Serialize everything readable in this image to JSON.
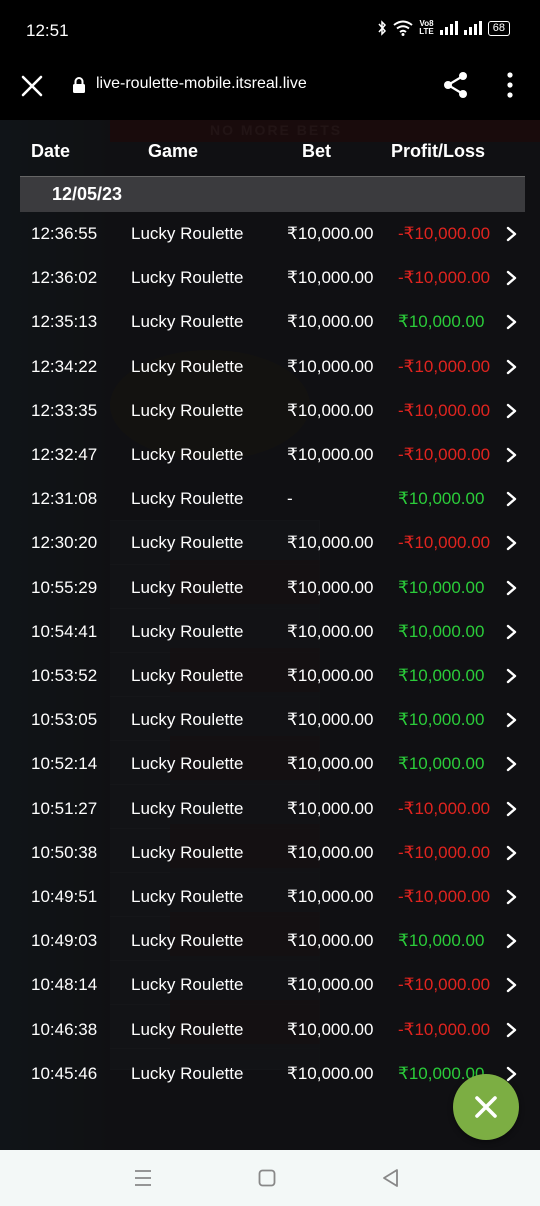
{
  "status_bar": {
    "time": "12:51",
    "network_label_top": "Vo8",
    "network_label_bottom": "LTE",
    "battery": "68"
  },
  "browser": {
    "url": "live-roulette-mobile.itsreal.live"
  },
  "background_text": {
    "banner": "NO MORE BETS"
  },
  "history": {
    "columns": {
      "date": "Date",
      "game": "Game",
      "bet": "Bet",
      "profit_loss": "Profit/Loss"
    },
    "date": "12/05/23",
    "rows": [
      {
        "time": "12:36:55",
        "game": "Lucky Roulette",
        "bet": "₹10,000.00",
        "pl": "-₹10,000.00",
        "result": "loss"
      },
      {
        "time": "12:36:02",
        "game": "Lucky Roulette",
        "bet": "₹10,000.00",
        "pl": "-₹10,000.00",
        "result": "loss"
      },
      {
        "time": "12:35:13",
        "game": "Lucky Roulette",
        "bet": "₹10,000.00",
        "pl": "₹10,000.00",
        "result": "win"
      },
      {
        "time": "12:34:22",
        "game": "Lucky Roulette",
        "bet": "₹10,000.00",
        "pl": "-₹10,000.00",
        "result": "loss"
      },
      {
        "time": "12:33:35",
        "game": "Lucky Roulette",
        "bet": "₹10,000.00",
        "pl": "-₹10,000.00",
        "result": "loss"
      },
      {
        "time": "12:32:47",
        "game": "Lucky Roulette",
        "bet": "₹10,000.00",
        "pl": "-₹10,000.00",
        "result": "loss"
      },
      {
        "time": "12:31:08",
        "game": "Lucky Roulette",
        "bet": "-",
        "pl": "₹10,000.00",
        "result": "win"
      },
      {
        "time": "12:30:20",
        "game": "Lucky Roulette",
        "bet": "₹10,000.00",
        "pl": "-₹10,000.00",
        "result": "loss"
      },
      {
        "time": "10:55:29",
        "game": "Lucky Roulette",
        "bet": "₹10,000.00",
        "pl": "₹10,000.00",
        "result": "win"
      },
      {
        "time": "10:54:41",
        "game": "Lucky Roulette",
        "bet": "₹10,000.00",
        "pl": "₹10,000.00",
        "result": "win"
      },
      {
        "time": "10:53:52",
        "game": "Lucky Roulette",
        "bet": "₹10,000.00",
        "pl": "₹10,000.00",
        "result": "win"
      },
      {
        "time": "10:53:05",
        "game": "Lucky Roulette",
        "bet": "₹10,000.00",
        "pl": "₹10,000.00",
        "result": "win"
      },
      {
        "time": "10:52:14",
        "game": "Lucky Roulette",
        "bet": "₹10,000.00",
        "pl": "₹10,000.00",
        "result": "win"
      },
      {
        "time": "10:51:27",
        "game": "Lucky Roulette",
        "bet": "₹10,000.00",
        "pl": "-₹10,000.00",
        "result": "loss"
      },
      {
        "time": "10:50:38",
        "game": "Lucky Roulette",
        "bet": "₹10,000.00",
        "pl": "-₹10,000.00",
        "result": "loss"
      },
      {
        "time": "10:49:51",
        "game": "Lucky Roulette",
        "bet": "₹10,000.00",
        "pl": "-₹10,000.00",
        "result": "loss"
      },
      {
        "time": "10:49:03",
        "game": "Lucky Roulette",
        "bet": "₹10,000.00",
        "pl": "₹10,000.00",
        "result": "win"
      },
      {
        "time": "10:48:14",
        "game": "Lucky Roulette",
        "bet": "₹10,000.00",
        "pl": "-₹10,000.00",
        "result": "loss"
      },
      {
        "time": "10:46:38",
        "game": "Lucky Roulette",
        "bet": "₹10,000.00",
        "pl": "-₹10,000.00",
        "result": "loss"
      },
      {
        "time": "10:45:46",
        "game": "Lucky Roulette",
        "bet": "₹10,000.00",
        "pl": "₹10,000.00",
        "result": "win"
      }
    ]
  },
  "colors": {
    "loss": "#e0241f",
    "win": "#2bcc3a",
    "fab": "#7cae43"
  },
  "icons": {
    "close": "close-icon",
    "lock": "lock-icon",
    "share": "share-icon",
    "menu": "more-vert-icon",
    "row_chevron": "chevron-right-icon",
    "fab": "close-icon",
    "nav_recents": "recents-icon",
    "nav_home": "home-icon",
    "nav_back": "back-icon"
  }
}
